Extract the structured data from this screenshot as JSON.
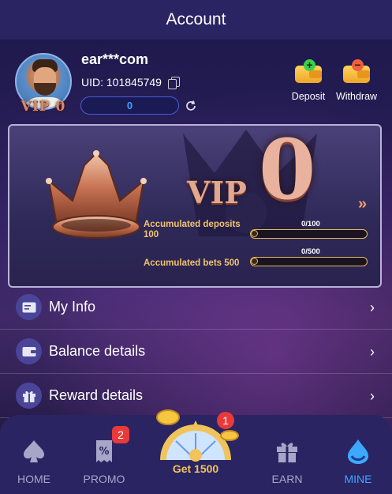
{
  "header": {
    "title": "Account"
  },
  "profile": {
    "username": "ear***com",
    "uid": "UID: 101845749",
    "vip_badge": "VIP 0",
    "balance": "0"
  },
  "actions": {
    "deposit": "Deposit",
    "withdraw": "Withdraw"
  },
  "vip": {
    "word": "VIP",
    "level": "0",
    "deposits": {
      "label_line1": "Accumulated deposits",
      "label_line2": "100",
      "count": "0/100",
      "progress": 0
    },
    "bets": {
      "label": "Accumulated bets 500",
      "count": "0/500",
      "progress": 0
    }
  },
  "menu": [
    {
      "label": "My Info",
      "icon": "id-card-icon"
    },
    {
      "label": "Balance details",
      "icon": "wallet-icon"
    },
    {
      "label": "Reward details",
      "icon": "gift-icon"
    }
  ],
  "nav": {
    "home": "HOME",
    "promo": "PROMO",
    "promo_badge": "2",
    "bonus": "Get 1500",
    "bonus_badge": "1",
    "earn": "EARN",
    "mine": "MINE"
  },
  "colors": {
    "header_bg": "#2a2463",
    "accent_blue": "#3ea8ff",
    "gold": "#f0c45a",
    "badge_red": "#e83a3a"
  }
}
